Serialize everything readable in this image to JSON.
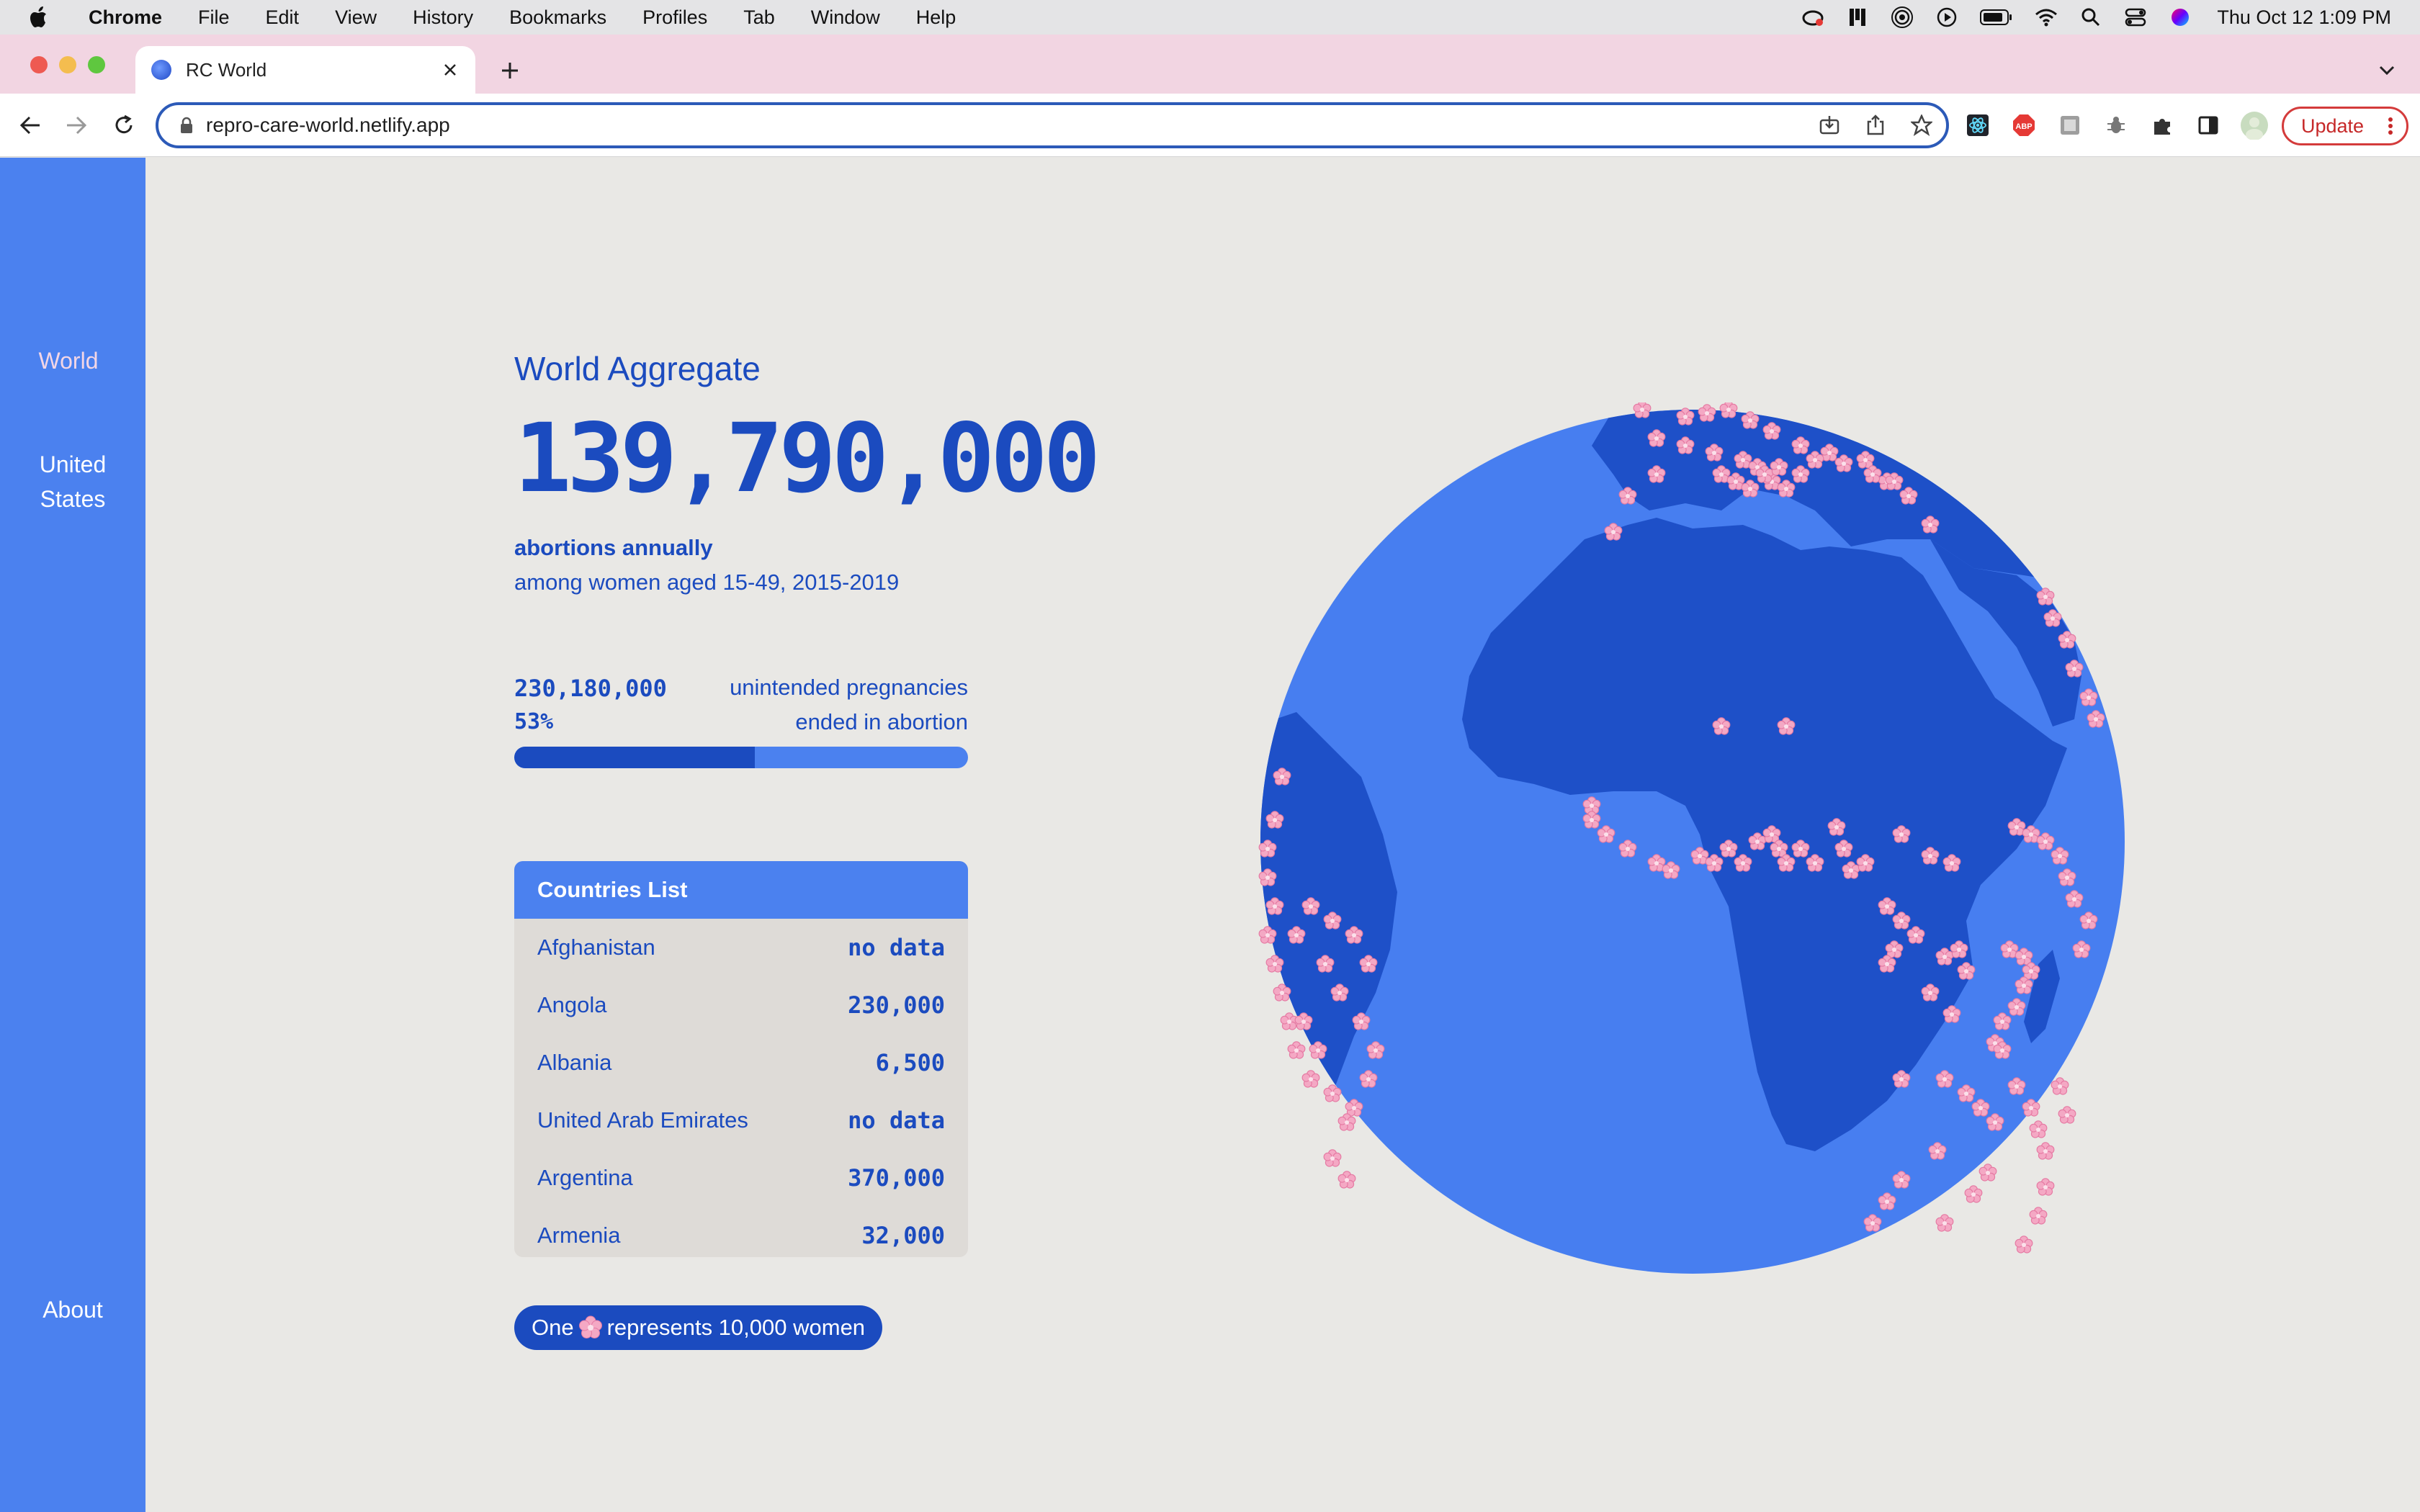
{
  "menubar": {
    "app_name": "Chrome",
    "items": [
      "File",
      "Edit",
      "View",
      "History",
      "Bookmarks",
      "Profiles",
      "Tab",
      "Window",
      "Help"
    ],
    "clock": "Thu Oct 12  1:09 PM"
  },
  "browser": {
    "tab_title": "RC World",
    "url": "repro-care-world.netlify.app",
    "update_label": "Update"
  },
  "sidebar": {
    "items": [
      {
        "label": "World",
        "active": true
      },
      {
        "label": "United States",
        "active": false
      }
    ],
    "about_label": "About"
  },
  "stats": {
    "heading": "World Aggregate",
    "total": "139,790,000",
    "total_label": "abortions annually",
    "subtitle": "among women aged 15-49, 2015-2019",
    "unintended_count": "230,180,000",
    "unintended_label": "unintended pregnancies",
    "percent": "53%",
    "percent_value": 0.53,
    "percent_label": "ended in abortion"
  },
  "countries": {
    "title": "Countries List",
    "rows": [
      {
        "name": "Afghanistan",
        "value": "no data"
      },
      {
        "name": "Angola",
        "value": "230,000"
      },
      {
        "name": "Albania",
        "value": "6,500"
      },
      {
        "name": "United Arab Emirates",
        "value": "no data"
      },
      {
        "name": "Argentina",
        "value": "370,000"
      },
      {
        "name": "Armenia",
        "value": "32,000"
      }
    ]
  },
  "legend": {
    "before": "One",
    "after": "represents 10,000 women"
  },
  "colors": {
    "sidebar": "#4b81ef",
    "accent": "#1b4bbf",
    "globe_ocean": "#477ef0",
    "globe_land": "#1e50c8",
    "flower": "#f4a8c4"
  }
}
